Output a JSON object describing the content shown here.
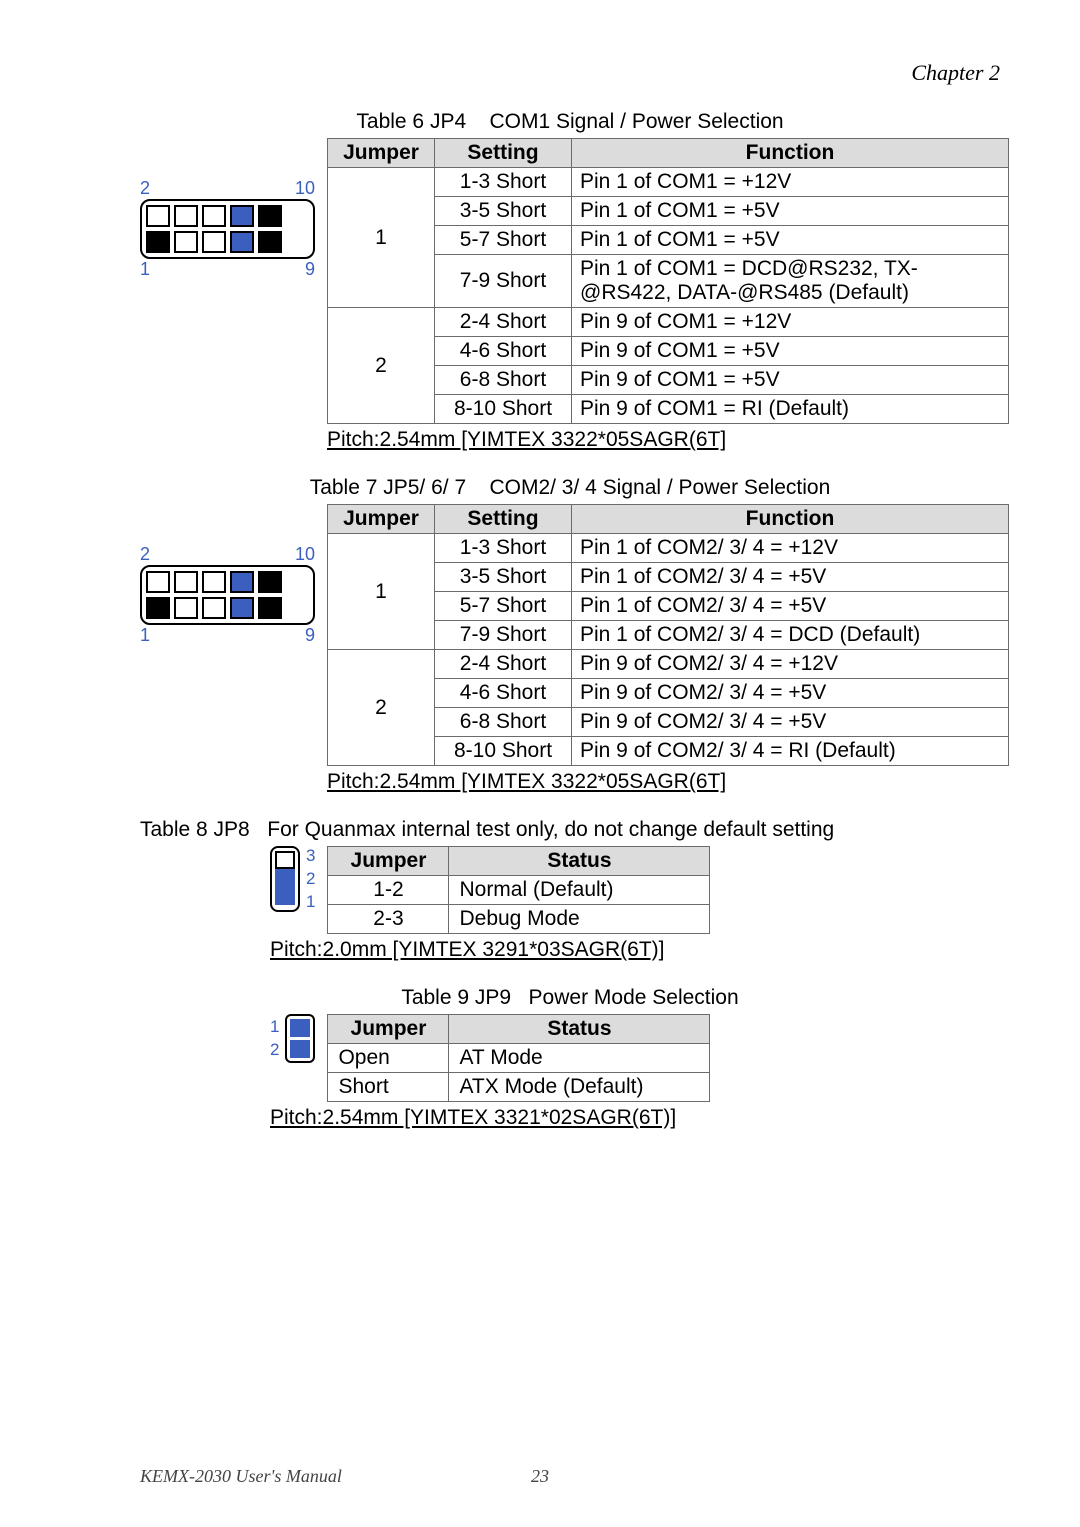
{
  "header": {
    "chapter": "Chapter  2"
  },
  "t6": {
    "caption": "Table 6 JP4    COM1 Signal / Power Selection",
    "headRow": {
      "jumper": "Jumper",
      "setting": "Setting",
      "function": "Function"
    },
    "groups": [
      {
        "jumper": "1",
        "rows": [
          {
            "setting": "1-3 Short",
            "function": "Pin 1 of COM1 = +12V"
          },
          {
            "setting": "3-5 Short",
            "function": "Pin 1 of COM1 = +5V"
          },
          {
            "setting": "5-7 Short",
            "function": "Pin 1 of COM1 = +5V"
          },
          {
            "setting": "7-9 Short",
            "function": "Pin 1 of COM1 = DCD@RS232, TX-@RS422, DATA-@RS485 (Default)"
          }
        ]
      },
      {
        "jumper": "2",
        "rows": [
          {
            "setting": "2-4 Short",
            "function": "Pin 9 of COM1 = +12V"
          },
          {
            "setting": "4-6 Short",
            "function": "Pin 9 of COM1 = +5V"
          },
          {
            "setting": "6-8 Short",
            "function": "Pin 9 of COM1 = +5V"
          },
          {
            "setting": "8-10 Short",
            "function": "Pin 9 of COM1 = RI (Default)"
          }
        ]
      }
    ],
    "pitch": "Pitch:2.54mm [YIMTEX 3322*05SAGR(6T]"
  },
  "t7": {
    "caption": "Table 7 JP5/ 6/ 7    COM2/ 3/ 4 Signal / Power Selection",
    "headRow": {
      "jumper": "Jumper",
      "setting": "Setting",
      "function": "Function"
    },
    "groups": [
      {
        "jumper": "1",
        "rows": [
          {
            "setting": "1-3 Short",
            "function": "Pin 1 of COM2/ 3/ 4 = +12V"
          },
          {
            "setting": "3-5 Short",
            "function": "Pin 1 of COM2/ 3/ 4 = +5V"
          },
          {
            "setting": "5-7 Short",
            "function": "Pin 1 of COM2/ 3/ 4 = +5V"
          },
          {
            "setting": "7-9 Short",
            "function": "Pin 1 of COM2/ 3/ 4 = DCD (Default)"
          }
        ]
      },
      {
        "jumper": "2",
        "rows": [
          {
            "setting": "2-4 Short",
            "function": "Pin 9 of COM2/ 3/ 4 = +12V"
          },
          {
            "setting": "4-6 Short",
            "function": "Pin 9 of COM2/ 3/ 4 = +5V"
          },
          {
            "setting": "6-8 Short",
            "function": "Pin 9 of COM2/ 3/ 4 = +5V"
          },
          {
            "setting": "8-10 Short",
            "function": "Pin 9 of COM2/ 3/ 4 = RI (Default)"
          }
        ]
      }
    ],
    "pitch": "Pitch:2.54mm [YIMTEX 3322*05SAGR(6T]"
  },
  "t8": {
    "caption": "Table 8 JP8   For Quanmax internal test only, do not change default setting",
    "headRow": {
      "jumper": "Jumper",
      "status": "Status"
    },
    "rows": [
      {
        "jumper": "1-2",
        "status": "Normal (Default)"
      },
      {
        "jumper": "2-3",
        "status": "Debug Mode"
      }
    ],
    "pitch": "Pitch:2.0mm [YIMTEX 3291*03SAGR(6T)]"
  },
  "t9": {
    "caption": "Table 9 JP9   Power Mode Selection",
    "headRow": {
      "jumper": "Jumper",
      "status": "Status"
    },
    "rows": [
      {
        "jumper": "Open",
        "status": "AT Mode"
      },
      {
        "jumper": "Short",
        "status": "ATX Mode (Default)"
      }
    ],
    "pitch": "Pitch:2.54mm [YIMTEX 3321*02SAGR(6T)]"
  },
  "hdr10_labels": {
    "tl": "2",
    "tr": "10",
    "bl": "1",
    "br": "9"
  },
  "hdr3_labels": {
    "a": "3",
    "b": "2",
    "c": "1"
  },
  "hdr2_labels": {
    "a": "1",
    "b": "2"
  },
  "footer": {
    "left": "KEMX-2030 User's Manual",
    "center": "23"
  }
}
